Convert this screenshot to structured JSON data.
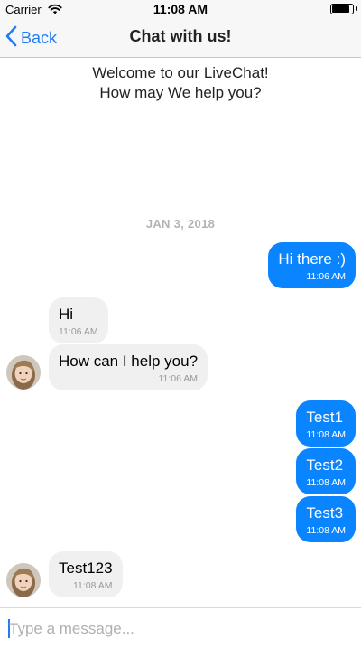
{
  "status_bar": {
    "carrier": "Carrier",
    "time": "11:08 AM",
    "battery_level": 0.85
  },
  "nav": {
    "back_label": "Back",
    "title": "Chat with us!"
  },
  "welcome": {
    "line1": "Welcome to our LiveChat!",
    "line2": "How may We help you?"
  },
  "date_separator": "JAN 3, 2018",
  "messages": [
    {
      "direction": "out",
      "text": "Hi there :)",
      "time": "11:06 AM"
    },
    {
      "direction": "in",
      "text": "Hi",
      "time": "11:06 AM"
    },
    {
      "direction": "in",
      "text": "How can I help you?",
      "time": "11:06 AM"
    },
    {
      "direction": "out",
      "text": "Test1",
      "time": "11:08 AM"
    },
    {
      "direction": "out",
      "text": "Test2",
      "time": "11:08 AM"
    },
    {
      "direction": "out",
      "text": "Test3",
      "time": "11:08 AM"
    },
    {
      "direction": "in",
      "text": "Test123",
      "time": "11:08 AM"
    }
  ],
  "input": {
    "placeholder": "Type a message..."
  },
  "colors": {
    "accent": "#1f7bf6",
    "outgoing_bubble": "#0a84ff",
    "incoming_bubble": "#f0f0f0"
  }
}
